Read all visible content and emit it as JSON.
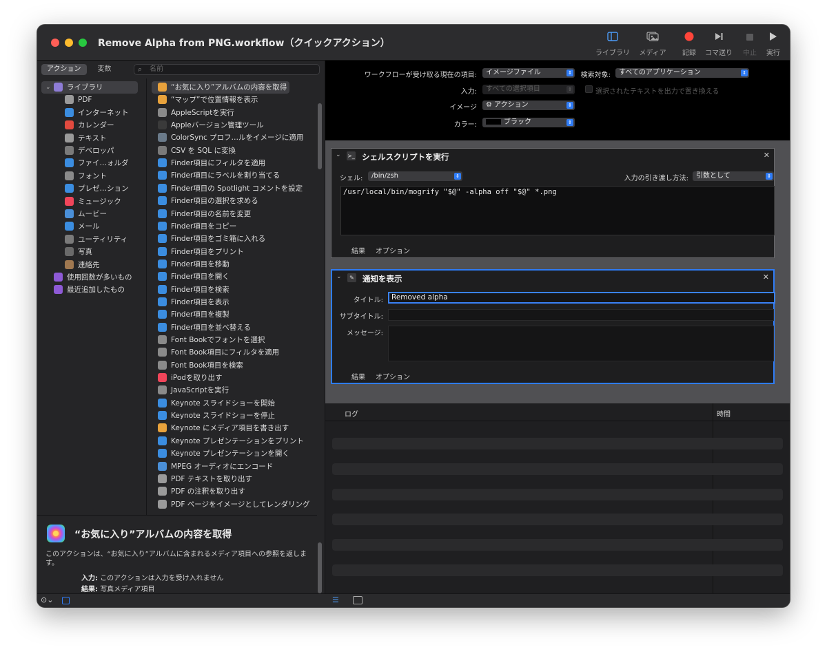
{
  "window": {
    "title": "Remove Alpha from PNG.workflow（クイックアクション）"
  },
  "toolbar": {
    "library_label": "ライブラリ",
    "media_label": "メディア",
    "record_label": "記録",
    "step_label": "コマ送り",
    "stop_label": "中止",
    "run_label": "実行"
  },
  "left": {
    "tab_actions": "アクション",
    "tab_variables": "変数",
    "search_placeholder": "名前",
    "library": [
      {
        "label": "ライブラリ",
        "icon": "library-folder-icon",
        "color": "#8e7cd6"
      },
      {
        "label": "PDF",
        "icon": "pdf-icon",
        "color": "#9a9a9a"
      },
      {
        "label": "インターネット",
        "icon": "globe-icon",
        "color": "#3b8de0"
      },
      {
        "label": "カレンダー",
        "icon": "calendar-icon",
        "color": "#e24a3f"
      },
      {
        "label": "テキスト",
        "icon": "text-icon",
        "color": "#9a9a9a"
      },
      {
        "label": "デベロッパ",
        "icon": "developer-icon",
        "color": "#7a7a7a"
      },
      {
        "label": "ファイ…ォルダ",
        "icon": "finder-icon",
        "color": "#3b8de0"
      },
      {
        "label": "フォント",
        "icon": "font-icon",
        "color": "#8a8a8a"
      },
      {
        "label": "プレゼ…ション",
        "icon": "keynote-icon",
        "color": "#3b8de0"
      },
      {
        "label": "ミュージック",
        "icon": "music-icon",
        "color": "#f0455a"
      },
      {
        "label": "ムービー",
        "icon": "movie-icon",
        "color": "#4a8fd8"
      },
      {
        "label": "メール",
        "icon": "mail-icon",
        "color": "#3b8de0"
      },
      {
        "label": "ユーティリティ",
        "icon": "utility-icon",
        "color": "#7a7a7a"
      },
      {
        "label": "写真",
        "icon": "photos-icon",
        "color": "#6a6a6a"
      },
      {
        "label": "連絡先",
        "icon": "contacts-icon",
        "color": "#a07850"
      },
      {
        "label": "使用回数が多いもの",
        "icon": "smart-folder-icon",
        "color": "#8e5ad6"
      },
      {
        "label": "最近追加したもの",
        "icon": "smart-folder-icon",
        "color": "#8e5ad6"
      }
    ],
    "actions": [
      {
        "label": "“お気に入り”アルバムの内容を取得",
        "color": "#e8a23c"
      },
      {
        "label": "“マップ”で位置情報を表示",
        "color": "#e8a23c"
      },
      {
        "label": "AppleScriptを実行",
        "color": "#8a8a8a"
      },
      {
        "label": "Appleバージョン管理ツール",
        "color": "#3a3a3a"
      },
      {
        "label": "ColorSync プロフ…ルをイメージに適用",
        "color": "#6a7a8a"
      },
      {
        "label": "CSV を SQL に変換",
        "color": "#7a7a7a"
      },
      {
        "label": "Finder項目にフィルタを適用",
        "color": "#3b8de0"
      },
      {
        "label": "Finder項目にラベルを割り当てる",
        "color": "#3b8de0"
      },
      {
        "label": "Finder項目の Spotlight コメントを設定",
        "color": "#3b8de0"
      },
      {
        "label": "Finder項目の選択を求める",
        "color": "#3b8de0"
      },
      {
        "label": "Finder項目の名前を変更",
        "color": "#3b8de0"
      },
      {
        "label": "Finder項目をコピー",
        "color": "#3b8de0"
      },
      {
        "label": "Finder項目をゴミ箱に入れる",
        "color": "#3b8de0"
      },
      {
        "label": "Finder項目をプリント",
        "color": "#3b8de0"
      },
      {
        "label": "Finder項目を移動",
        "color": "#3b8de0"
      },
      {
        "label": "Finder項目を開く",
        "color": "#3b8de0"
      },
      {
        "label": "Finder項目を検索",
        "color": "#3b8de0"
      },
      {
        "label": "Finder項目を表示",
        "color": "#3b8de0"
      },
      {
        "label": "Finder項目を複製",
        "color": "#3b8de0"
      },
      {
        "label": "Finder項目を並べ替える",
        "color": "#3b8de0"
      },
      {
        "label": "Font Bookでフォントを選択",
        "color": "#8a8a8a"
      },
      {
        "label": "Font Book項目にフィルタを適用",
        "color": "#8a8a8a"
      },
      {
        "label": "Font Book項目を検索",
        "color": "#8a8a8a"
      },
      {
        "label": "iPodを取り出す",
        "color": "#f0455a"
      },
      {
        "label": "JavaScriptを実行",
        "color": "#8a8a8a"
      },
      {
        "label": "Keynote スライドショーを開始",
        "color": "#3b8de0"
      },
      {
        "label": "Keynote スライドショーを停止",
        "color": "#3b8de0"
      },
      {
        "label": "Keynote にメディア項目を書き出す",
        "color": "#e8a23c"
      },
      {
        "label": "Keynote プレゼンテーションをプリント",
        "color": "#3b8de0"
      },
      {
        "label": "Keynote プレゼンテーションを開く",
        "color": "#3b8de0"
      },
      {
        "label": "MPEG オーディオにエンコード",
        "color": "#4a8fd8"
      },
      {
        "label": "PDF テキストを取り出す",
        "color": "#9a9a9a"
      },
      {
        "label": "PDF の注釈を取り出す",
        "color": "#9a9a9a"
      },
      {
        "label": "PDF ページをイメージとしてレンダリング",
        "color": "#9a9a9a"
      }
    ],
    "description": {
      "title": "“お気に入り”アルバムの内容を取得",
      "text": "このアクションは、“お気に入り”アルバムに含まれるメディア項目への参照を返します。",
      "input_label": "入力:",
      "input_value": "このアクションは入力を受け入れません",
      "result_label": "結果:",
      "result_value": "写真メディア項目"
    }
  },
  "workflow": {
    "receives_label": "ワークフローが受け取る現在の項目:",
    "receives_value": "イメージファイル",
    "search_label": "検索対象:",
    "search_value": "すべてのアプリケーション",
    "input_label": "入力:",
    "input_value": "すべての選択項目",
    "replace_label": "選択されたテキストを出力で置き換える",
    "image_label": "イメージ",
    "image_value": "⚙ アクション",
    "color_label": "カラー:",
    "color_value": "ブラック"
  },
  "shell_action": {
    "title": "シェルスクリプトを実行",
    "shell_label": "シェル:",
    "shell_value": "/bin/zsh",
    "pass_label": "入力の引き渡し方法:",
    "pass_value": "引数として",
    "script": "/usr/local/bin/mogrify \"$@\" -alpha off \"$@\" *.png",
    "tab_results": "結果",
    "tab_options": "オプション"
  },
  "notify_action": {
    "title": "通知を表示",
    "title_label": "タイトル:",
    "title_value": "Removed alpha",
    "subtitle_label": "サブタイトル:",
    "message_label": "メッセージ:",
    "tab_results": "結果",
    "tab_options": "オプション"
  },
  "log": {
    "col_log": "ログ",
    "col_time": "時間"
  },
  "colors": {
    "accent": "#2f7cf6",
    "record": "#ff453a"
  }
}
